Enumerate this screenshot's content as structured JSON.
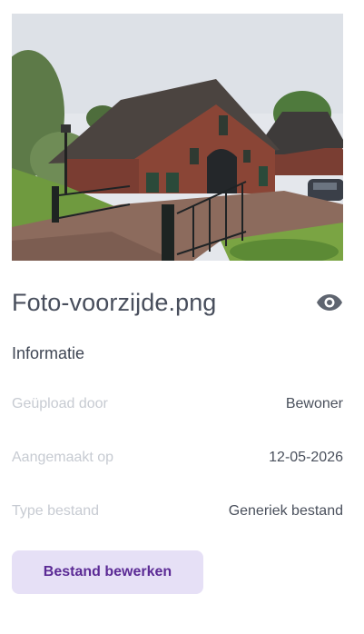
{
  "file": {
    "name": "Foto-voorzijde.png",
    "preview_alt": "Foto-voorzijde.png"
  },
  "icons": {
    "view": "eye-icon"
  },
  "info": {
    "title": "Informatie",
    "rows": [
      {
        "label": "Geüpload door",
        "value": "Bewoner"
      },
      {
        "label": "Aangemaakt op",
        "value": "12-05-2026"
      },
      {
        "label": "Type bestand",
        "value": "Generiek bestand"
      }
    ]
  },
  "actions": {
    "edit_label": "Bestand bewerken"
  },
  "colors": {
    "accent_text": "#5b2a95",
    "accent_bg": "#e6e0f6"
  }
}
